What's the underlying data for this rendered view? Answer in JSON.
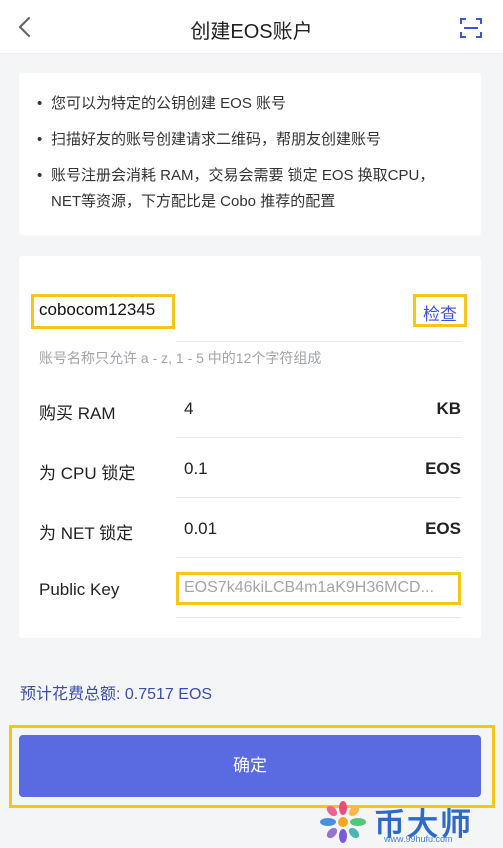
{
  "header": {
    "title": "创建EOS账户",
    "back_icon": "chevron-left-icon",
    "scan_icon": "qr-scan-icon"
  },
  "info": {
    "lines": [
      "您可以为特定的公钥创建 EOS 账号",
      "扫描好友的账号创建请求二维码，帮朋友创建账号",
      "账号注册会消耗 RAM，交易会需要 锁定 EOS 换取CPU，NET等资源，下方配比是 Cobo 推荐的配置"
    ]
  },
  "form": {
    "account_name": "cobocom12345",
    "check_label": "检查",
    "hint": "账号名称只允许 a - z, 1 - 5 中的12个字符组成",
    "rows": [
      {
        "label": "购买 RAM",
        "value": "4",
        "unit": "KB"
      },
      {
        "label": "为 CPU 锁定",
        "value": "0.1",
        "unit": "EOS"
      },
      {
        "label": "为 NET 锁定",
        "value": "0.01",
        "unit": "EOS"
      }
    ],
    "public_key_label": "Public Key",
    "public_key_value": "EOS7k46kiLCB4m1aK9H36MCD..."
  },
  "total": "预计花费总额: 0.7517 EOS",
  "confirm_label": "确定",
  "watermark": {
    "name": "币大师",
    "url": "www.99hufu.com"
  },
  "colors": {
    "accent": "#5a6ae0",
    "link": "#3e54d8",
    "highlight": "#f5c518"
  }
}
